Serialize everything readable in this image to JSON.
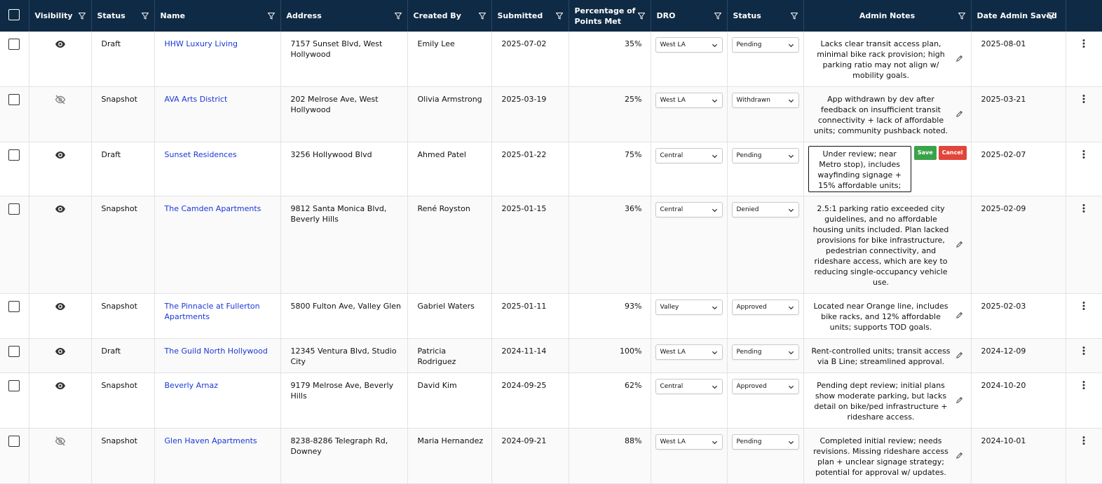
{
  "header": {
    "visibility": "Visibility",
    "status": "Status",
    "name": "Name",
    "address": "Address",
    "created_by": "Created By",
    "submitted": "Submitted",
    "percentage_line1": "Percentage of",
    "percentage_line2": "Points Met",
    "dro": "DRO",
    "status2": "Status",
    "admin_notes": "Admin Notes",
    "date_saved": "Date Admin Saved"
  },
  "editor": {
    "save_label": "Save",
    "cancel_label": "Cancel"
  },
  "rows": [
    {
      "visibility": "eye-icon",
      "status": "Draft",
      "name": "HHW Luxury Living",
      "address": "7157 Sunset Blvd, West Hollywood",
      "created_by": "Emily Lee",
      "submitted": "2025-07-02",
      "percent": "35%",
      "dro": "West LA",
      "review_status": "Pending",
      "notes": "Lacks clear transit access plan, minimal bike rack provision; high parking ratio may not align w/ mobility goals.",
      "date_saved": "2025-08-01"
    },
    {
      "visibility": "eye-off-icon",
      "status": "Snapshot",
      "name": "AVA Arts District",
      "address": "202 Melrose Ave, West Hollywood",
      "created_by": "Olivia Armstrong",
      "submitted": "2025-03-19",
      "percent": "25%",
      "dro": "West LA",
      "review_status": "Withdrawn",
      "notes": "App withdrawn by dev after feedback on insufficient transit connectivity + lack of affordable units; community pushback noted.",
      "date_saved": "2025-03-21"
    },
    {
      "visibility": "eye-icon",
      "status": "Draft",
      "name": "Sunset Residences",
      "address": "3256 Hollywood Blvd",
      "created_by": "Ahmed Patel",
      "submitted": "2025-01-22",
      "percent": "75%",
      "dro": "Central",
      "review_status": "Pending",
      "notes": "Under review; near Metro stop), includes wayfinding signage + 15% affordable units; parking ratio TBD.",
      "date_saved": "2025-02-07",
      "editing": true
    },
    {
      "visibility": "eye-icon",
      "status": "Snapshot",
      "name": "The Camden Apartments",
      "address": "9812 Santa Monica Blvd, Beverly Hills",
      "created_by": "René Royston",
      "submitted": "2025-01-15",
      "percent": "36%",
      "dro": "Central",
      "review_status": "Denied",
      "notes": "2.5:1 parking ratio exceeded city guidelines, and no affordable housing units included. Plan lacked provisions for bike infrastructure, pedestrian connectivity, and rideshare access, which are key to reducing single-occupancy vehicle use.",
      "date_saved": "2025-02-09"
    },
    {
      "visibility": "eye-icon",
      "status": "Snapshot",
      "name": "The Pinnacle at Fullerton Apartments",
      "address": "5800 Fulton Ave, Valley Glen",
      "created_by": "Gabriel Waters",
      "submitted": "2025-01-11",
      "percent": "93%",
      "dro": "Valley",
      "review_status": "Approved",
      "notes": "Located near Orange line, includes bike racks, and 12% affordable units; supports TOD goals.",
      "date_saved": "2025-02-03"
    },
    {
      "visibility": "eye-icon",
      "status": "Draft",
      "name": "The Guild North Hollywood",
      "address": "12345 Ventura Blvd, Studio City",
      "created_by": "Patricia Rodriguez",
      "submitted": "2024-11-14",
      "percent": "100%",
      "dro": "West LA",
      "review_status": "Pending",
      "notes": "Rent-controlled units; transit access via B Line; streamlined approval.",
      "date_saved": "2024-12-09"
    },
    {
      "visibility": "eye-icon",
      "status": "Snapshot",
      "name": "Beverly Arnaz",
      "address": "9179 Melrose Ave, Beverly Hills",
      "created_by": "David Kim",
      "submitted": "2024-09-25",
      "percent": "62%",
      "dro": "Central",
      "review_status": "Approved",
      "notes": "Pending dept review; initial plans show moderate parking, but lacks detail on bike/ped infrastructure + rideshare access.",
      "date_saved": "2024-10-20"
    },
    {
      "visibility": "eye-off-icon",
      "status": "Snapshot",
      "name": "Glen Haven Apartments",
      "address": "8238-8286 Telegraph Rd, Downey",
      "created_by": "Maria Hernandez",
      "submitted": "2024-09-21",
      "percent": "88%",
      "dro": "West LA",
      "review_status": "Pending",
      "notes": "Completed initial review; needs revisions. Missing rideshare access plan + unclear signage strategy; potential for approval w/ updates.",
      "date_saved": "2024-10-01"
    }
  ]
}
